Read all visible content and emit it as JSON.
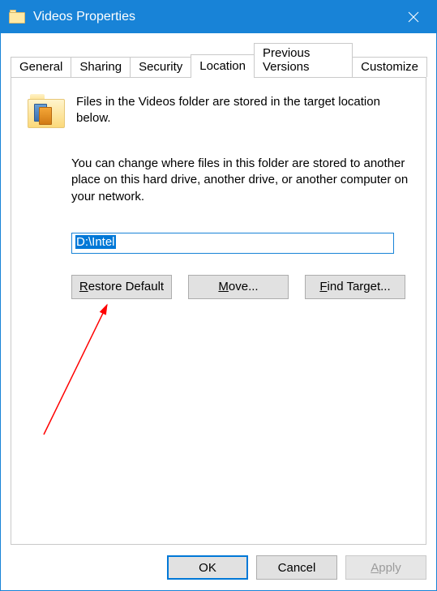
{
  "titlebar": {
    "title": "Videos Properties"
  },
  "tabs": {
    "general": "General",
    "sharing": "Sharing",
    "security": "Security",
    "location": "Location",
    "previous": "Previous Versions",
    "customize": "Customize"
  },
  "location": {
    "intro": "Files in the Videos folder are stored in the target location below.",
    "desc": "You can change where files in this folder are stored to another place on this hard drive, another drive, or another computer on your network.",
    "path": "D:\\Intel",
    "restore_pre": "R",
    "restore_post": "estore Default",
    "move_pre": "M",
    "move_post": "ove...",
    "find_pre": "F",
    "find_post": "ind Target..."
  },
  "buttons": {
    "ok": "OK",
    "cancel": "Cancel",
    "apply_pre": "A",
    "apply_post": "pply"
  }
}
